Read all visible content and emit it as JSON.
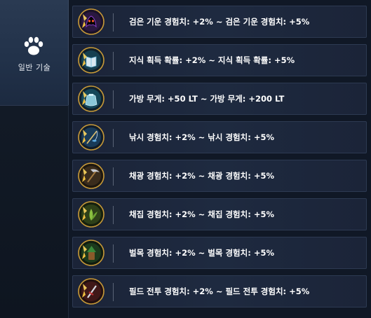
{
  "sidebar": {
    "tab_label": "일반 기술",
    "tab_icon": "paw-icon"
  },
  "skills": [
    {
      "text": "검은 기운 경험치: +2% ~ 검은 기운 경험치: +5%",
      "icon": "black-spirit-icon",
      "accent": "#8a3cc8"
    },
    {
      "text": "지식 획득 확률: +2% ~ 지식 획득 확률: +5%",
      "icon": "knowledge-book-icon",
      "accent": "#3aa0c8"
    },
    {
      "text": "가방 무게: +50 LT ~ 가방 무게: +200 LT",
      "icon": "bag-weight-icon",
      "accent": "#2a9ab8"
    },
    {
      "text": "낚시 경험치: +2% ~ 낚시 경험치: +5%",
      "icon": "fishing-icon",
      "accent": "#2a8cc8"
    },
    {
      "text": "채광 경험치: +2% ~ 채광 경험치: +5%",
      "icon": "mining-pickaxe-icon",
      "accent": "#8a6a3a"
    },
    {
      "text": "채집 경험치: +2% ~ 채집 경험치: +5%",
      "icon": "gathering-icon",
      "accent": "#6aa030"
    },
    {
      "text": "벌목 경험치: +2% ~ 벌목 경험치: +5%",
      "icon": "lumbering-icon",
      "accent": "#3a8a3a"
    },
    {
      "text": "필드 전투 경험치: +2% ~ 필드 전투 경험치: +5%",
      "icon": "field-combat-icon",
      "accent": "#c03030"
    }
  ]
}
